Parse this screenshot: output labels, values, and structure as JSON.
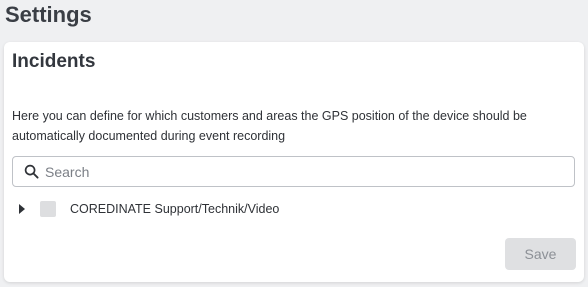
{
  "page": {
    "title": "Settings"
  },
  "incidents": {
    "title": "Incidents",
    "description": "Here you can define for which customers and areas the GPS position of the device should be automatically documented during event recording",
    "search": {
      "placeholder": "Search",
      "value": "",
      "icon": "search-icon"
    },
    "tree": [
      {
        "label": "COREDINATE Support/Technik/Video",
        "expanded": false,
        "checked": false,
        "expand_icon": "caret-right-icon"
      }
    ],
    "save_label": "Save"
  },
  "colors": {
    "background": "#eff0f2",
    "card": "#ffffff",
    "button_disabled_bg": "#dfe0e2",
    "button_disabled_text": "#8c9096",
    "checkbox": "#dddee0"
  }
}
